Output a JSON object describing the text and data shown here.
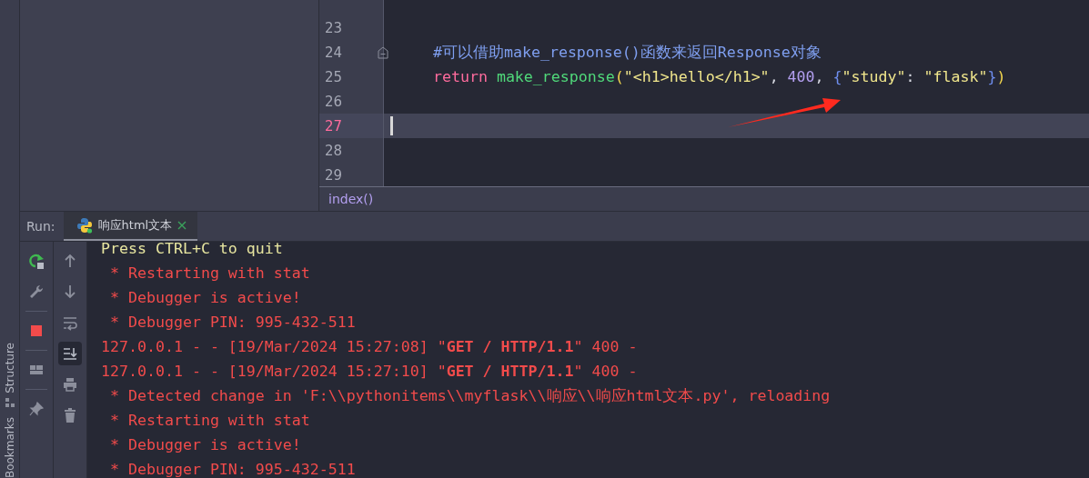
{
  "side_tabs": [
    {
      "label": "Structure"
    },
    {
      "label": "Bookmarks"
    }
  ],
  "editor": {
    "lines": [
      {
        "number": "23",
        "current": false,
        "fold": false
      },
      {
        "number": "24",
        "current": false,
        "fold": true,
        "tokens": [
          {
            "kind": "comment",
            "text": "#可以借助make_response()函数来返回Response对象"
          }
        ]
      },
      {
        "number": "25",
        "current": false,
        "fold": false,
        "tokens": [
          {
            "kind": "keyword",
            "text": "return "
          },
          {
            "kind": "func",
            "text": "make_response"
          },
          {
            "kind": "paren",
            "text": "("
          },
          {
            "kind": "string",
            "text": "\"<h1>hello</h1>\""
          },
          {
            "kind": "plain",
            "text": ", "
          },
          {
            "kind": "number",
            "text": "400"
          },
          {
            "kind": "plain",
            "text": ", "
          },
          {
            "kind": "brace",
            "text": "{"
          },
          {
            "kind": "string",
            "text": "\"study\""
          },
          {
            "kind": "plain",
            "text": ": "
          },
          {
            "kind": "string",
            "text": "\"flask\""
          },
          {
            "kind": "brace",
            "text": "}"
          },
          {
            "kind": "paren",
            "text": ")"
          }
        ]
      },
      {
        "number": "26",
        "current": false,
        "fold": false
      },
      {
        "number": "27",
        "current": true,
        "fold": false
      },
      {
        "number": "28",
        "current": false,
        "fold": false
      },
      {
        "number": "29",
        "current": false,
        "fold": false
      }
    ],
    "breadcrumb": "index()"
  },
  "run": {
    "label": "Run:",
    "tabs": [
      {
        "label": "响应html文本",
        "selected": true
      }
    ]
  },
  "console_toolbar": [
    {
      "selected": false
    },
    {
      "selected": false
    },
    {
      "selected": false
    },
    {
      "selected": true
    },
    {
      "selected": false
    },
    {
      "selected": false
    }
  ],
  "console": [
    {
      "kind": "info",
      "text": "Press CTRL+C to quit"
    },
    {
      "kind": "error",
      "text": " * Restarting with stat"
    },
    {
      "kind": "error",
      "text": " * Debugger is active!"
    },
    {
      "kind": "error",
      "text": " * Debugger PIN: 995-432-511"
    },
    {
      "kind": "error",
      "text": "127.0.0.1 - - [19/Mar/2024 15:27:08] \"**GET / HTTP/1.1**\" 400 -"
    },
    {
      "kind": "error",
      "text": "127.0.0.1 - - [19/Mar/2024 15:27:10] \"**GET / HTTP/1.1**\" 400 -"
    },
    {
      "kind": "error",
      "text": " * Detected change in 'F:\\\\pythonitems\\\\myflask\\\\响应\\\\响应html文本.py', reloading"
    },
    {
      "kind": "error",
      "text": " * Restarting with stat"
    },
    {
      "kind": "error",
      "text": " * Debugger is active!"
    },
    {
      "kind": "error",
      "text": " * Debugger PIN: 995-432-511"
    }
  ]
}
